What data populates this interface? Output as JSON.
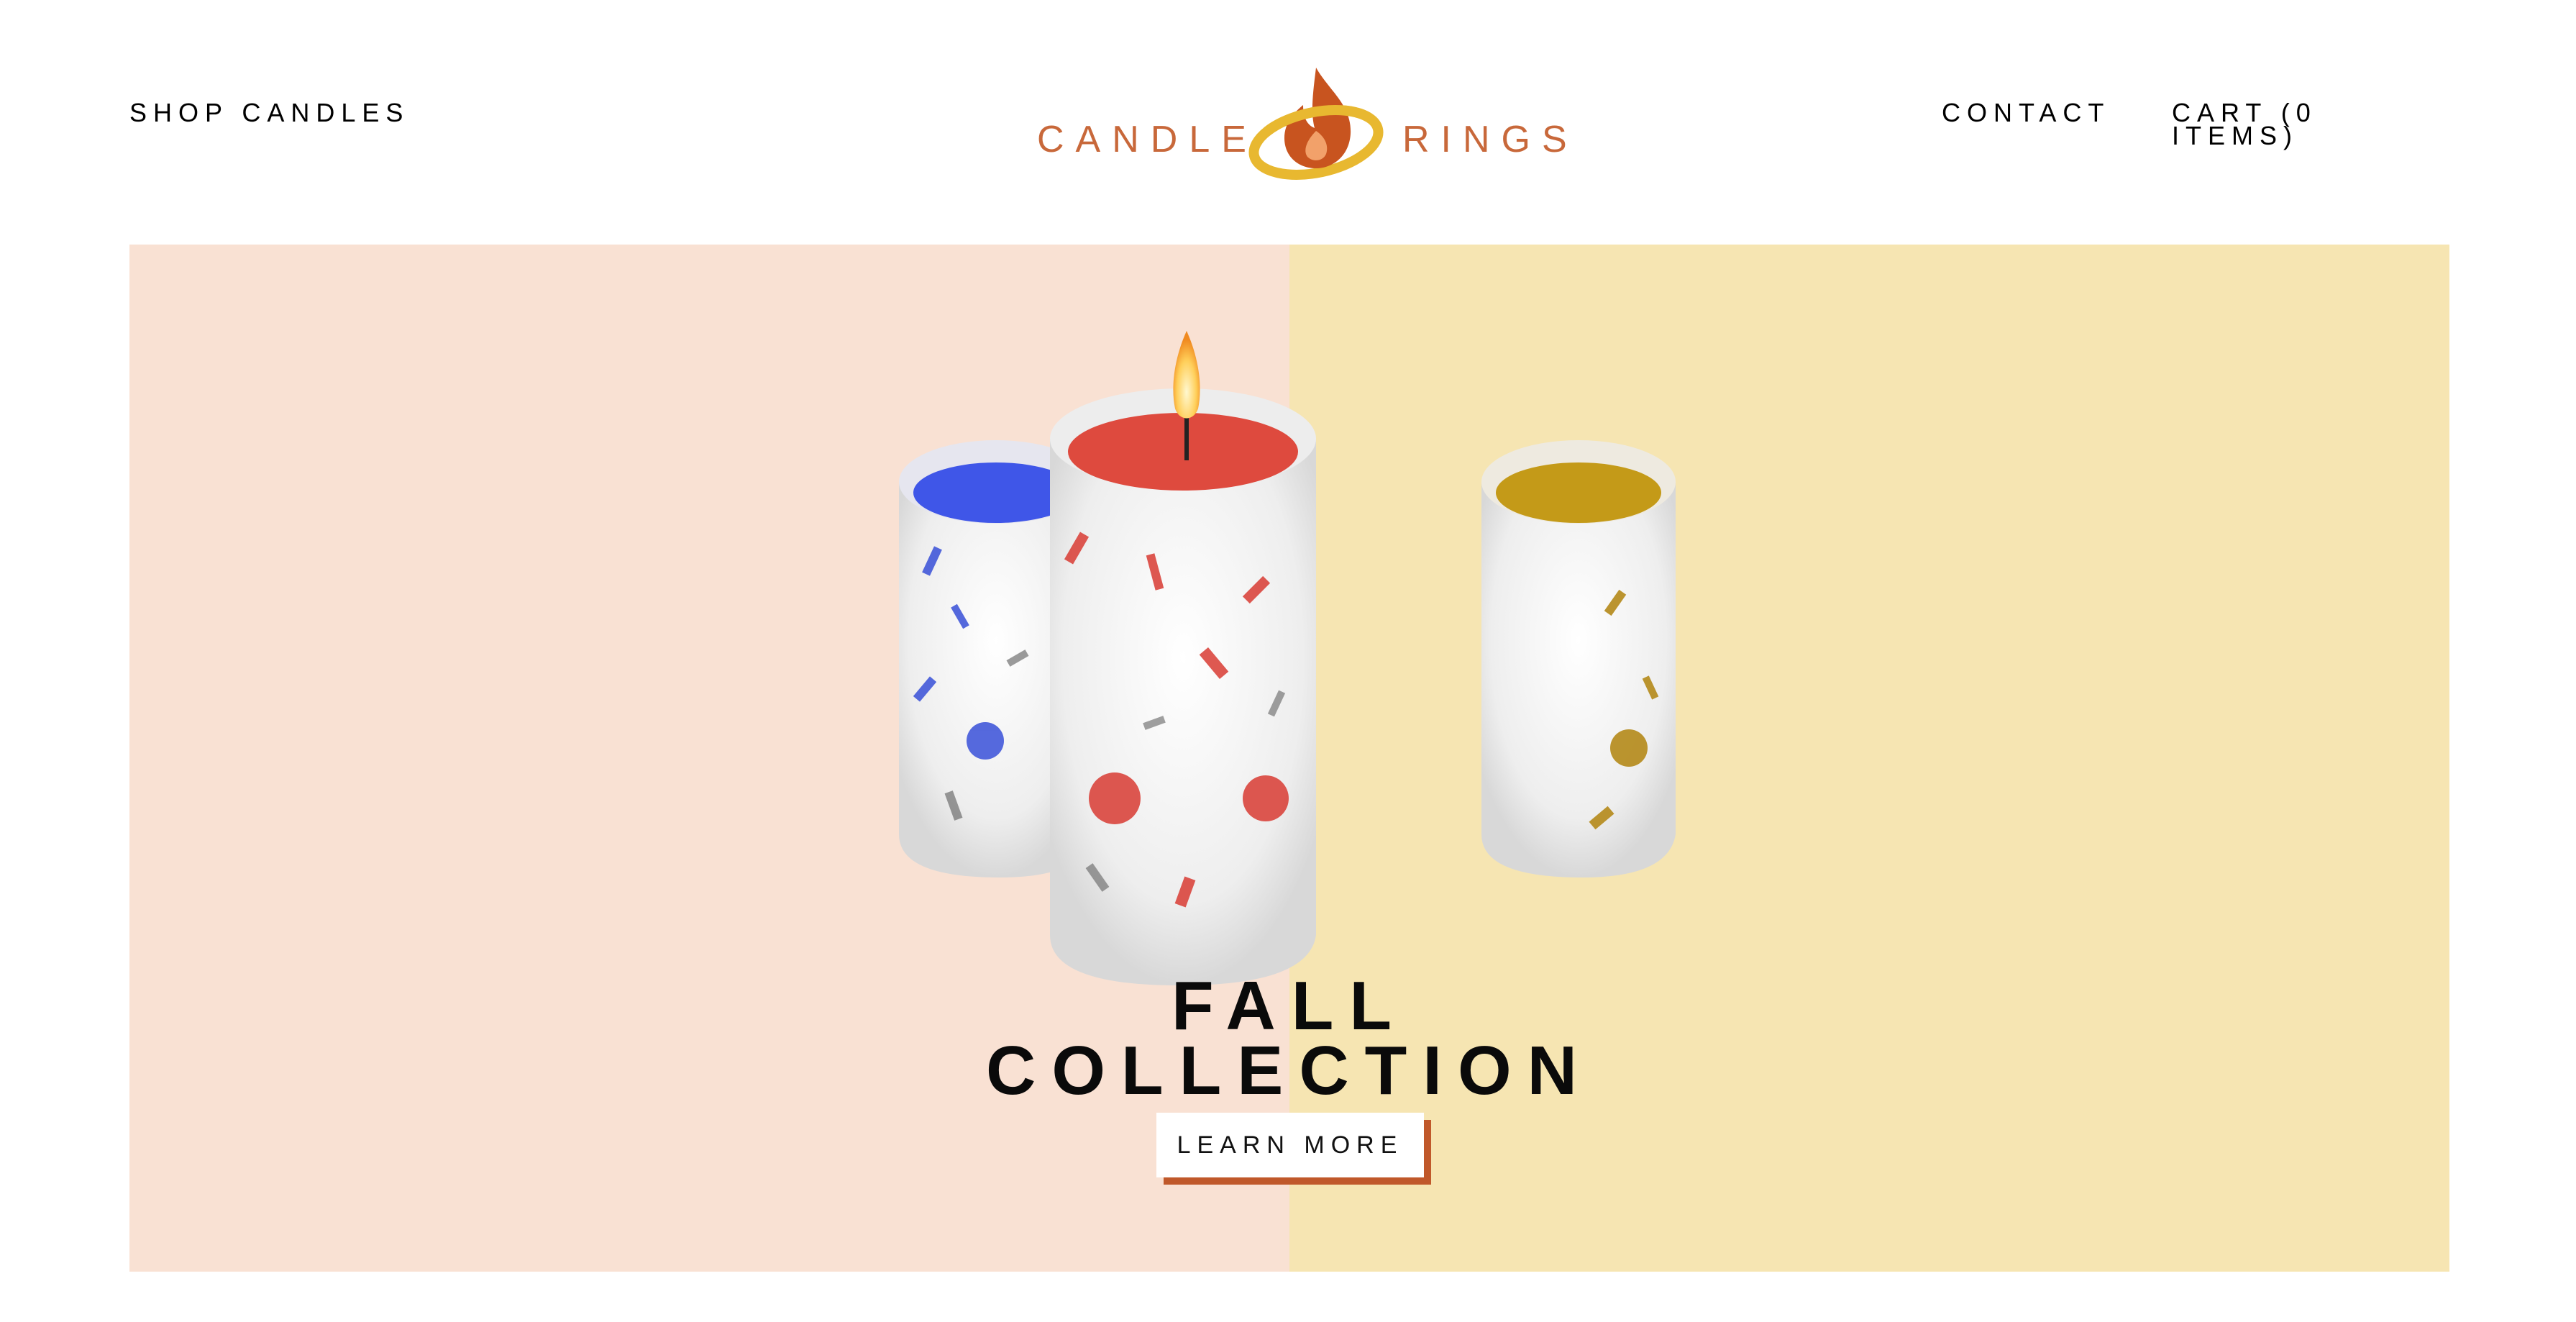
{
  "header": {
    "nav_left": "SHOP CANDLES",
    "logo": {
      "left_word": "CANDLE",
      "right_word": "RINGS"
    },
    "nav_contact": "CONTACT",
    "nav_cart": "CART (0 ITEMS)"
  },
  "hero": {
    "title_line1": "FALL",
    "title_line2": "COLLECTION",
    "cta_label": "LEARN MORE",
    "colors": {
      "left_bg": "#f9e1d3",
      "right_bg": "#f6e5b2",
      "cta_accent": "#c0582a"
    },
    "image": "three-flower-candles-image"
  },
  "brand": {
    "accent": "#c8683a",
    "ring": "#e8b830"
  }
}
